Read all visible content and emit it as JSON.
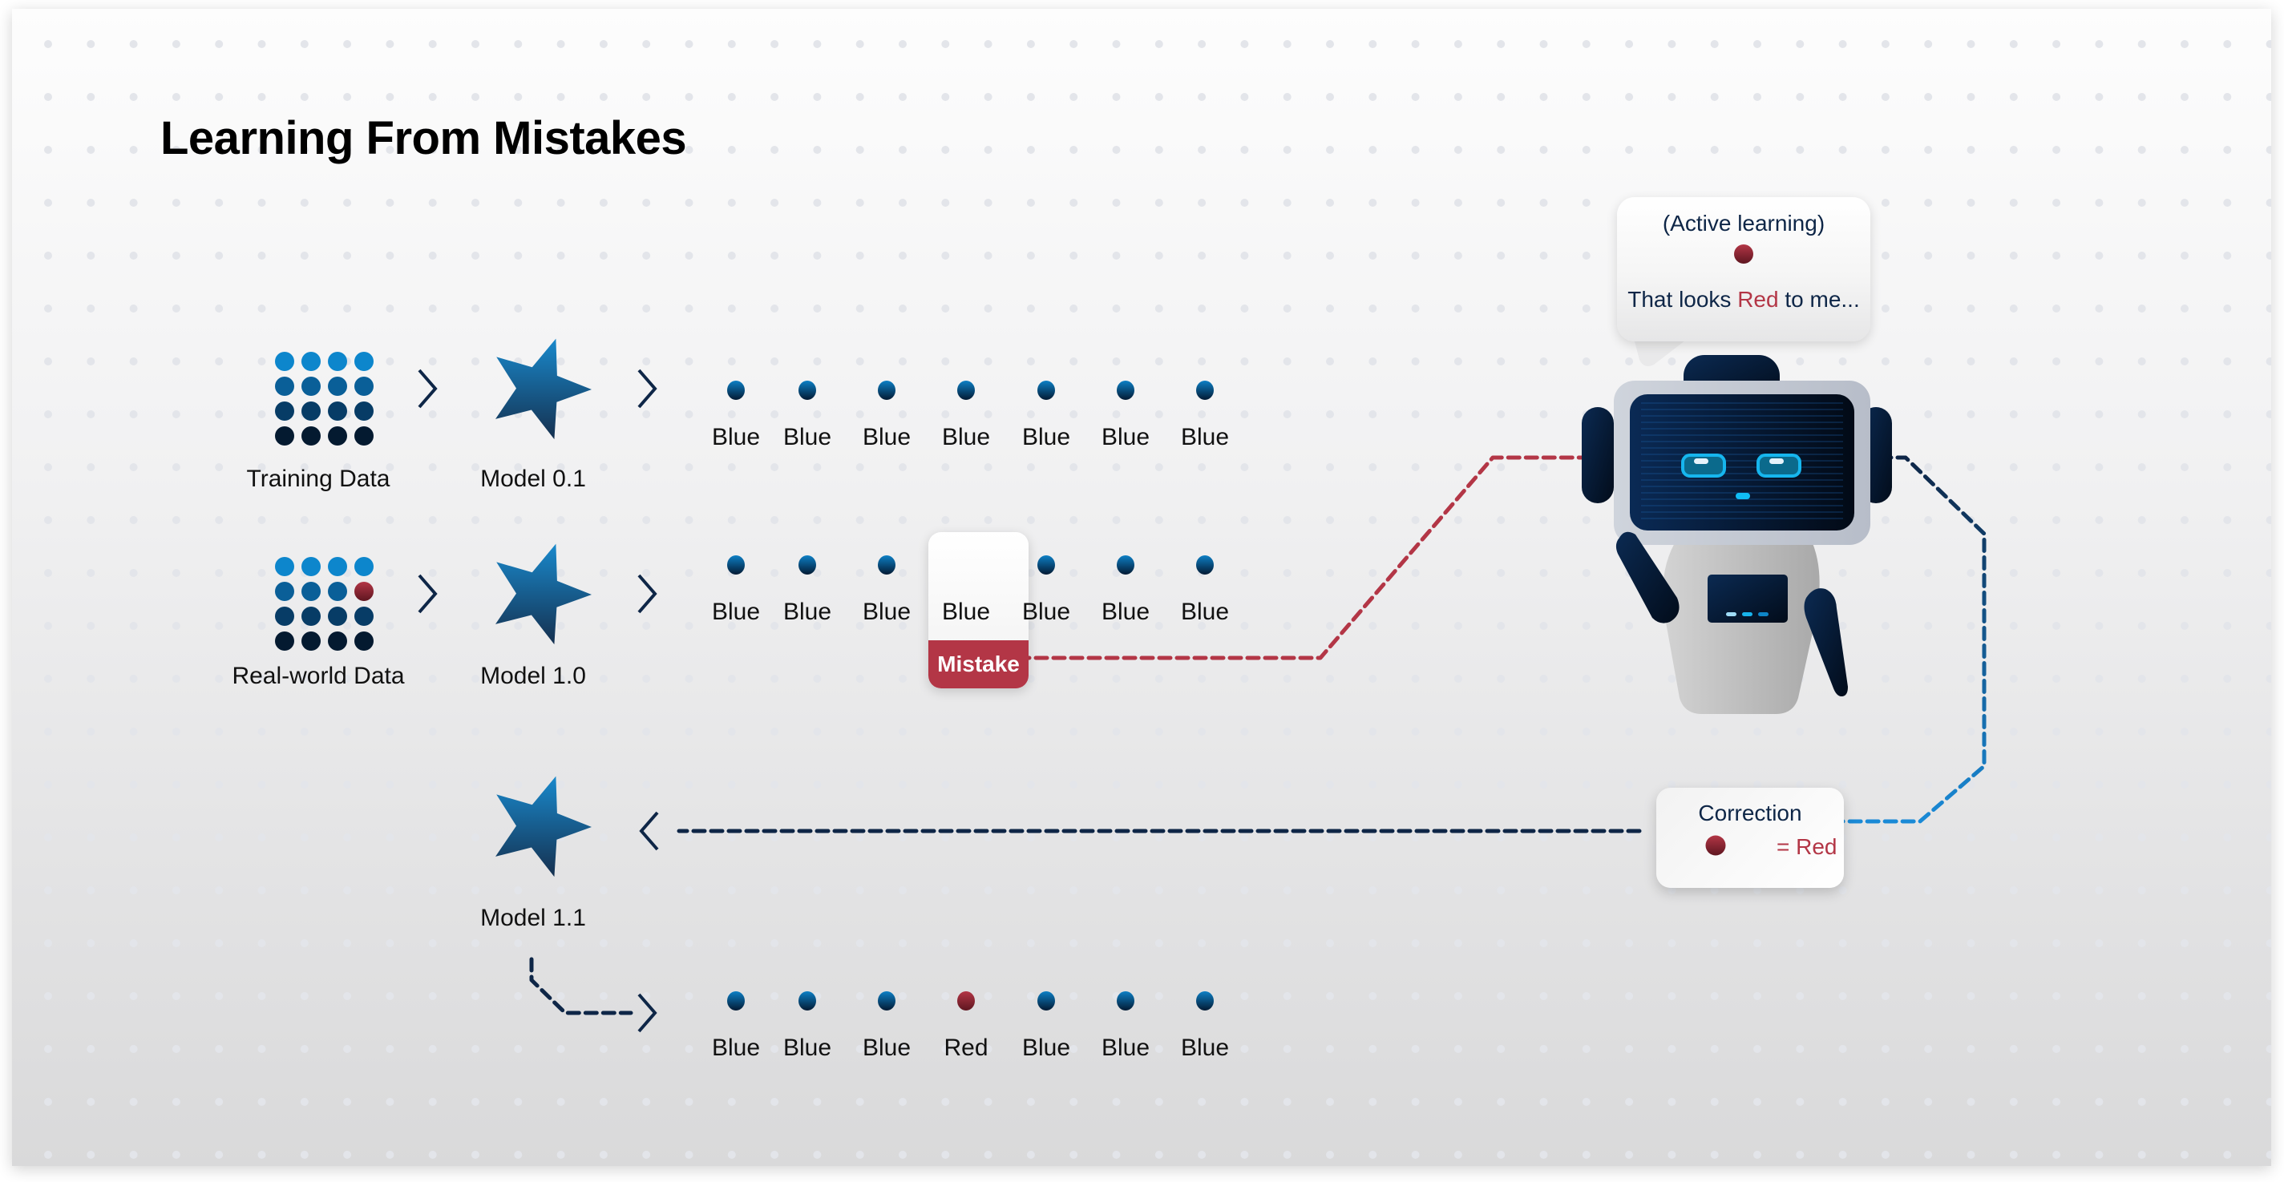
{
  "title": "Learning From Mistakes",
  "colors": {
    "navy": "#0e2647",
    "blue_light": "#0f86cc",
    "blue_dark": "#041428",
    "red": "#b33646",
    "red_dark": "#6e1a26",
    "connector_red": "#b33646",
    "connector_navy": "#0e2647",
    "connector_blue": "#1582cc"
  },
  "rows": [
    {
      "source_label": "Training Data",
      "source_grid": [
        [
          "blue",
          "blue",
          "blue",
          "blue"
        ],
        [
          "blue",
          "blue",
          "blue",
          "blue"
        ],
        [
          "blue",
          "blue",
          "blue",
          "blue"
        ],
        [
          "blue",
          "blue",
          "blue",
          "blue"
        ]
      ],
      "model_label": "Model 0.1",
      "predictions": [
        {
          "dot": "blue",
          "label": "Blue"
        },
        {
          "dot": "blue",
          "label": "Blue"
        },
        {
          "dot": "blue",
          "label": "Blue"
        },
        {
          "dot": "blue",
          "label": "Blue"
        },
        {
          "dot": "blue",
          "label": "Blue"
        },
        {
          "dot": "blue",
          "label": "Blue"
        },
        {
          "dot": "blue",
          "label": "Blue"
        }
      ]
    },
    {
      "source_label": "Real-world Data",
      "source_grid": [
        [
          "blue",
          "blue",
          "blue",
          "blue"
        ],
        [
          "blue",
          "blue",
          "blue",
          "red"
        ],
        [
          "blue",
          "blue",
          "blue",
          "blue"
        ],
        [
          "blue",
          "blue",
          "blue",
          "blue"
        ]
      ],
      "model_label": "Model 1.0",
      "predictions": [
        {
          "dot": "blue",
          "label": "Blue"
        },
        {
          "dot": "blue",
          "label": "Blue"
        },
        {
          "dot": "blue",
          "label": "Blue"
        },
        {
          "dot": "red",
          "label": "Blue",
          "mistake": true
        },
        {
          "dot": "blue",
          "label": "Blue"
        },
        {
          "dot": "blue",
          "label": "Blue"
        },
        {
          "dot": "blue",
          "label": "Blue"
        }
      ],
      "mistake_label": "Mistake"
    },
    {
      "model_label": "Model 1.1",
      "predictions": [
        {
          "dot": "blue",
          "label": "Blue"
        },
        {
          "dot": "blue",
          "label": "Blue"
        },
        {
          "dot": "blue",
          "label": "Blue"
        },
        {
          "dot": "red",
          "label": "Red"
        },
        {
          "dot": "blue",
          "label": "Blue"
        },
        {
          "dot": "blue",
          "label": "Blue"
        },
        {
          "dot": "blue",
          "label": "Blue"
        }
      ]
    }
  ],
  "robot": {
    "bubble": {
      "heading": "(Active learning)",
      "dot": "red",
      "text_before": "That looks ",
      "text_highlight": "Red",
      "text_after": " to me..."
    }
  },
  "correction": {
    "title": "Correction",
    "dot": "red",
    "equation": "= Red"
  },
  "icons": {
    "chevron_right": "chevron-right-icon",
    "chevron_left": "chevron-left-icon",
    "model": "star-icon",
    "data": "dot-grid-icon",
    "robot": "robot-icon"
  }
}
